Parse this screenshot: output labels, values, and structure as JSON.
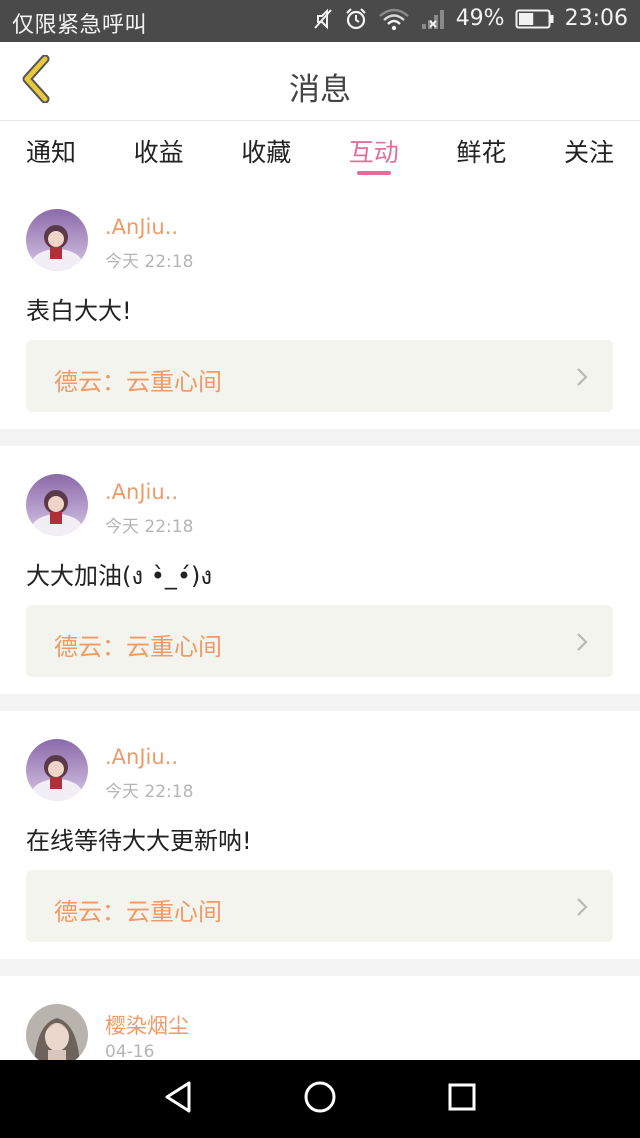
{
  "status_bar": {
    "carrier_text": "仅限紧急呼叫",
    "battery_percent": "49%",
    "time": "23:06",
    "battery_level": 0.49,
    "icons": [
      "mute-icon",
      "alarm-icon",
      "wifi-icon",
      "signal-icon",
      "battery-icon"
    ]
  },
  "header": {
    "title": "消息",
    "back_icon": "chevron-left-icon",
    "accent_color": "#e8c93a"
  },
  "tabs": [
    {
      "label": "通知",
      "active": false
    },
    {
      "label": "收益",
      "active": false
    },
    {
      "label": "收藏",
      "active": false
    },
    {
      "label": "互动",
      "active": true
    },
    {
      "label": "鲜花",
      "active": false
    },
    {
      "label": "关注",
      "active": false
    }
  ],
  "colors": {
    "active_tab": "#e0709a",
    "username": "#ef9a68",
    "link_background": "#f4f4ee"
  },
  "messages": [
    {
      "username": ".AnJiu..",
      "time": "今天 22:18",
      "text": "表白大大!",
      "work": "德云：云重心间"
    },
    {
      "username": ".AnJiu..",
      "time": "今天 22:18",
      "text": "大大加油(ง •̀_•́)ง",
      "work": "德云：云重心间"
    },
    {
      "username": ".AnJiu..",
      "time": "今天 22:18",
      "text": "在线等待大大更新呐!",
      "work": "德云：云重心间"
    },
    {
      "username": "樱染烟尘",
      "time": "04-16"
    }
  ],
  "nav_bar": {
    "icons": [
      "back-triangle-icon",
      "home-circle-icon",
      "recents-square-icon"
    ]
  }
}
